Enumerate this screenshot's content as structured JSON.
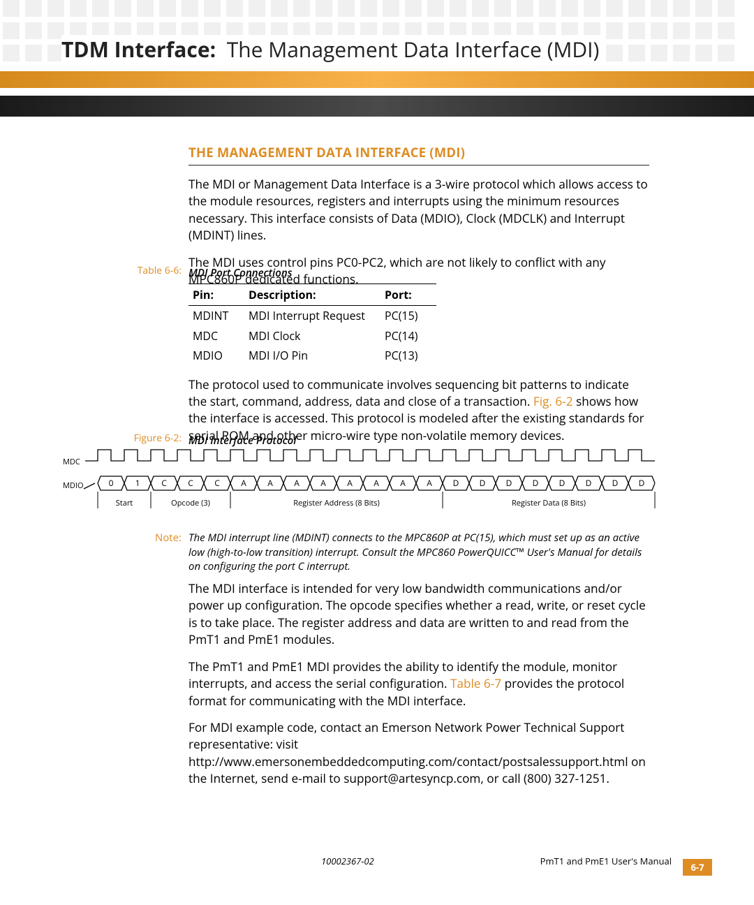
{
  "header": {
    "title_bold": "TDM Interface:",
    "title_rest": "The Management Data Interface (MDI)"
  },
  "section": {
    "heading": "THE MANAGEMENT DATA INTERFACE (MDI)",
    "p1": "The MDI or Management Data Interface is a 3-wire protocol which allows access to the module resources, registers and interrupts using the minimum resources necessary. This interface consists of Data (MDIO), Clock (MDCLK) and Interrupt (MDINT) lines.",
    "p2": "The MDI uses control pins PC0-PC2, which are not likely to conflict with any MPC860P dedicated functions.",
    "table_label": "Table 6-6:",
    "table_caption": "MDI Port Connections",
    "table": {
      "headers": {
        "c1": "Pin:",
        "c2": "Description:",
        "c3": "Port:"
      },
      "rows": [
        {
          "c1": "MDINT",
          "c2": "MDI Interrupt Request",
          "c3": "PC(15)"
        },
        {
          "c1": "MDC",
          "c2": "MDI Clock",
          "c3": "PC(14)"
        },
        {
          "c1": "MDIO",
          "c2": "MDI I/O Pin",
          "c3": "PC(13)"
        }
      ]
    },
    "p3a": "The protocol used to communicate involves sequencing bit patterns to indicate the start, command, address, data and close of a transaction. ",
    "p3_ref": "Fig. 6-2",
    "p3b": " shows how the interface is accessed. This protocol is modeled after the existing standards for serial ROM and other micro-wire type non-volatile memory devices.",
    "fig_label": "Figure 6-2:",
    "fig_caption": "MDI Interface Protocol"
  },
  "diagram": {
    "mdc_label": "MDC",
    "mdio_label": "MDIO",
    "bits": [
      "0",
      "1",
      "C",
      "C",
      "C",
      "A",
      "A",
      "A",
      "A",
      "A",
      "A",
      "A",
      "A",
      "D",
      "D",
      "D",
      "D",
      "D",
      "D",
      "D",
      "D"
    ],
    "groups": {
      "start": "Start",
      "opcode": "Opcode (3)",
      "regaddr": "Register Address (8 Bits)",
      "regdata": "Register Data (8 Bits)"
    }
  },
  "note": {
    "label": "Note:",
    "text": "The MDI interrupt line (MDINT) connects to the MPC860P at PC(15), which must set up as an active low (high-to-low transition) interrupt. Consult the MPC860 PowerQUICC™ User's Manual for details on configuring the port C interrupt."
  },
  "after_note": {
    "p4": "The MDI interface is intended for very low bandwidth communications and/or power up configuration. The opcode specifies whether a read, write, or reset cycle is to take place. The register address and data are written to and read from the PmT1 and PmE1 modules.",
    "p5a": "The PmT1 and PmE1 MDI provides the ability to identify the module, monitor interrupts, and access the serial configuration. ",
    "p5_ref": "Table 6-7",
    "p5b": " provides the protocol format for communicating with the MDI interface.",
    "p6": "For MDI example code, contact an Emerson Network Power Technical Support representative: visit http://www.emersonembeddedcomputing.com/contact/postsalessupport.html on the Internet, send e-mail to support@artesyncp.com, or call (800) 327-1251."
  },
  "footer": {
    "docid": "10002367-02",
    "manual": "PmT1 and PmE1 User's Manual",
    "page": "6-7"
  }
}
